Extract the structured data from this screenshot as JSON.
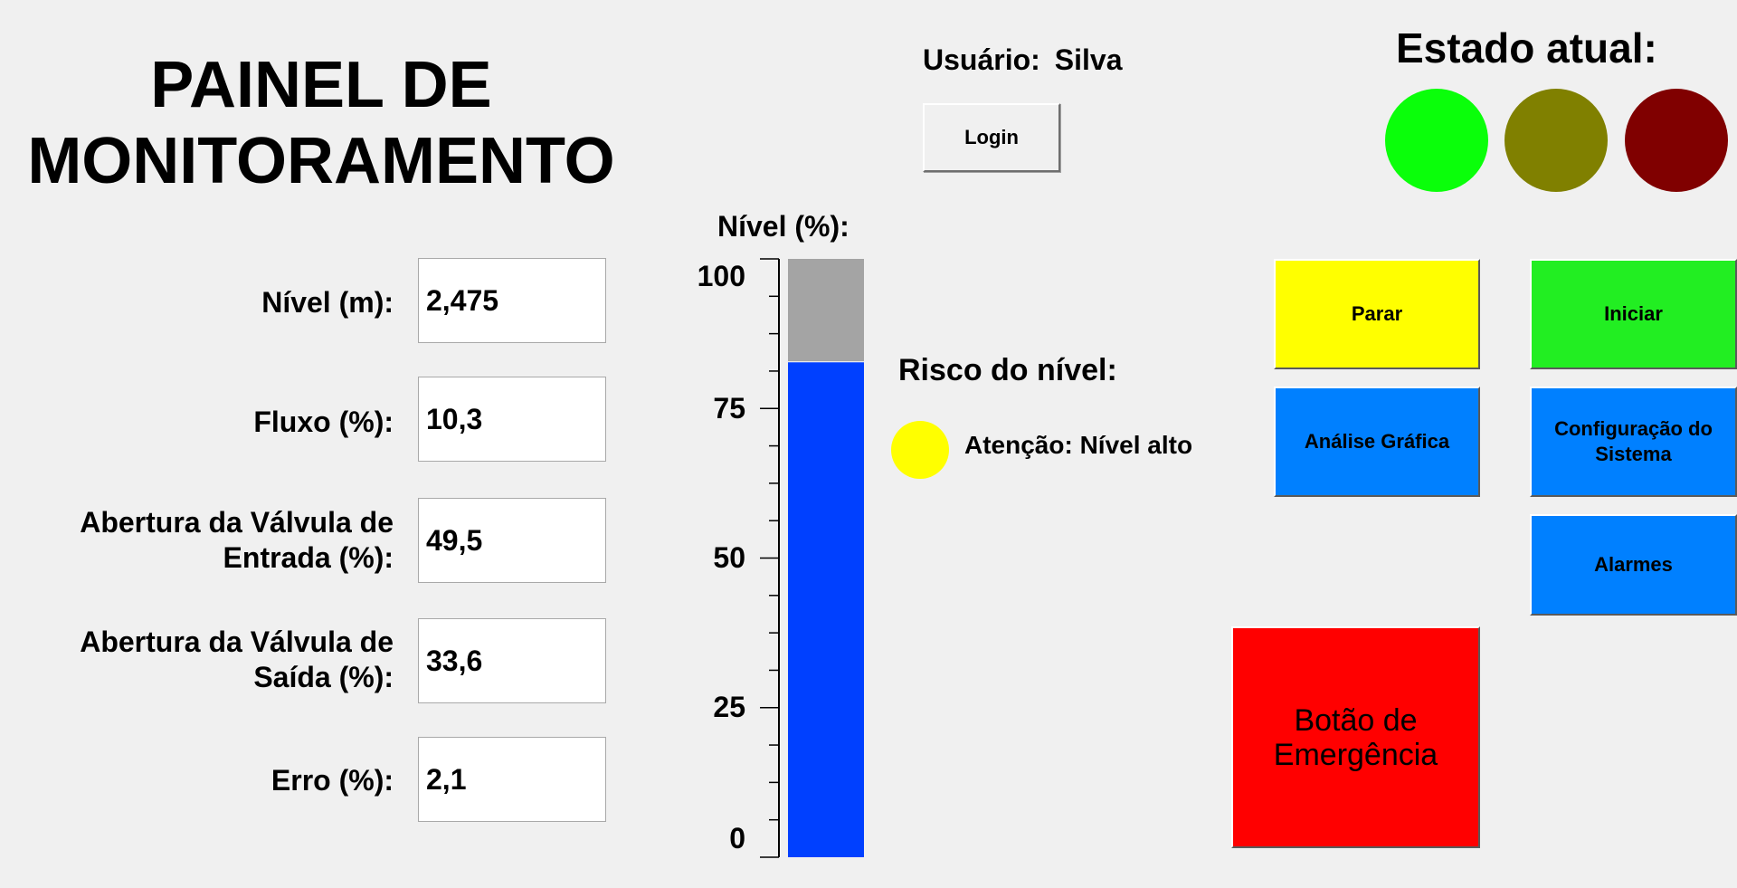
{
  "header": {
    "title_line1": "PAINEL DE",
    "title_line2": "MONITORAMENTO",
    "user_label": "Usuário:",
    "user_name": "Silva",
    "login_label": "Login"
  },
  "state": {
    "title": "Estado atual:",
    "lamps": [
      {
        "color": "#0aff0a"
      },
      {
        "color": "#808000"
      },
      {
        "color": "#800000"
      }
    ]
  },
  "fields": [
    {
      "label_line1": "Nível (m):",
      "label_line2": "",
      "value": "2,475"
    },
    {
      "label_line1": "Fluxo (%):",
      "label_line2": "",
      "value": "10,3"
    },
    {
      "label_line1": "Abertura da Válvula de",
      "label_line2": "Entrada (%):",
      "value": "49,5"
    },
    {
      "label_line1": "Abertura da Válvula de",
      "label_line2": "Saída (%):",
      "value": "33,6"
    },
    {
      "label_line1": "Erro (%):",
      "label_line2": "",
      "value": "2,1"
    }
  ],
  "chart_data": {
    "type": "bar",
    "title": "Nível (%):",
    "values": [
      82.8
    ],
    "ylim": [
      0,
      100
    ],
    "yticks": [
      "0",
      "25",
      "50",
      "75",
      "100"
    ],
    "fill_color": "#0040ff",
    "empty_color": "#a4a4a4"
  },
  "risk": {
    "title": "Risco do nível:",
    "color": "#ffff00",
    "text": "Atenção: Nível alto"
  },
  "buttons": {
    "stop_label": "Parar",
    "start_label": "Iniciar",
    "graph_label": "Análise Gráfica",
    "config_label": "Configuração do Sistema",
    "alarms_label": "Alarmes",
    "emergency_label": "Botão de Emergência",
    "colors": {
      "stop": "#ffff00",
      "start": "#22ee22",
      "blue": "#0080ff",
      "emergency": "#ff0000"
    }
  }
}
